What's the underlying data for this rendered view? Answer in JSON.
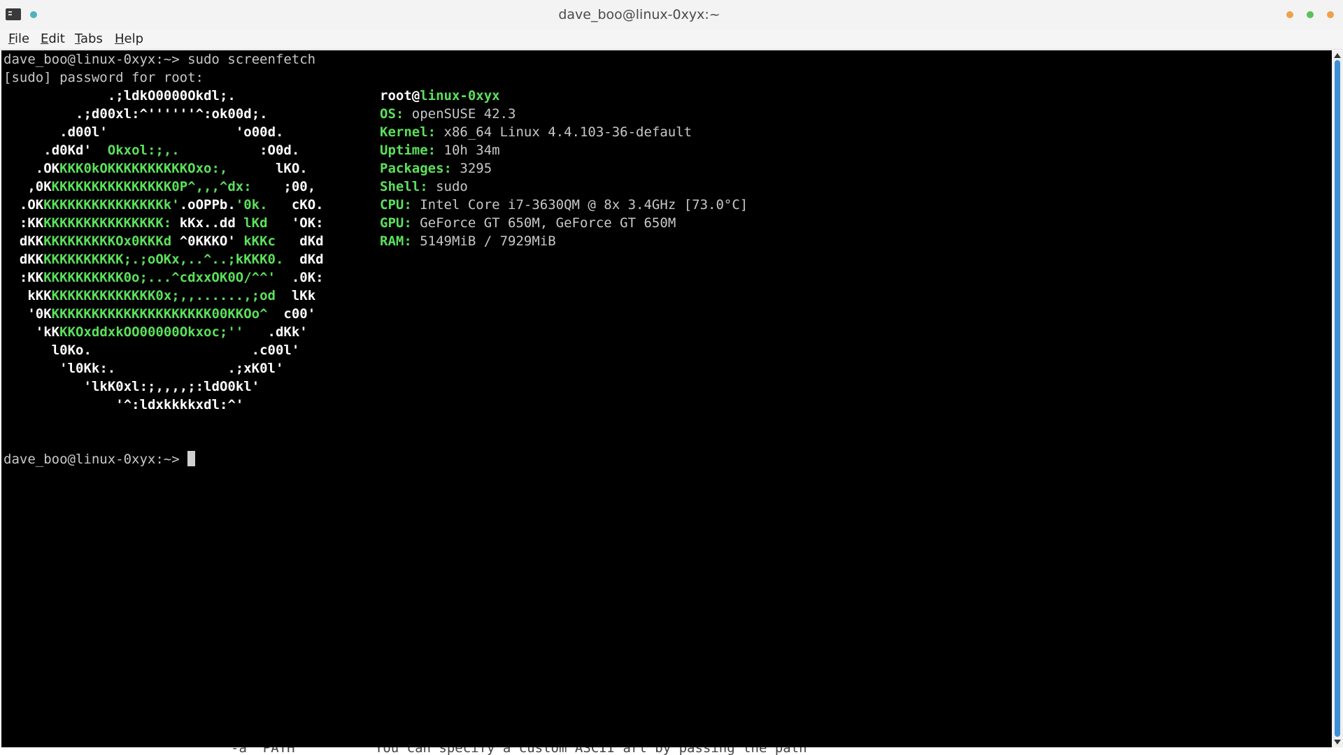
{
  "window": {
    "title": "dave_boo@linux-0xyx:~",
    "controls": {
      "minimize_color": "#f0a04b",
      "maximize_color": "#5cc05c",
      "close_color": "#f0a04b"
    }
  },
  "menu": {
    "items": [
      {
        "mnemonic": "F",
        "rest": "ile"
      },
      {
        "mnemonic": "E",
        "rest": "dit"
      },
      {
        "mnemonic": "T",
        "rest": "abs"
      },
      {
        "mnemonic": "H",
        "rest": "elp"
      }
    ]
  },
  "terminal": {
    "command_line": "dave_boo@linux-0xyx:~> sudo screenfetch",
    "sudo_prompt": "[sudo] password for root:",
    "final_prompt": "dave_boo@linux-0xyx:~> ",
    "colors": {
      "background": "#000000",
      "text": "#c8c8c8",
      "accent_green": "#5be05b"
    },
    "ascii_art": [
      {
        "indent": 13,
        "segments": [
          {
            "t": ".;ldkO0000Okdl;.",
            "g": false
          }
        ]
      },
      {
        "indent": 9,
        "segments": [
          {
            "t": ".;d00xl:^''''''^:ok00d;.",
            "g": false
          }
        ]
      },
      {
        "indent": 7,
        "segments": [
          {
            "t": ".d00l'",
            "g": false
          },
          {
            "t": "                ",
            "g": false
          },
          {
            "t": "'o00d.",
            "g": false
          }
        ]
      },
      {
        "indent": 5,
        "segments": [
          {
            "t": ".d0Kd'  ",
            "g": false
          },
          {
            "t": "Okxol:;,.",
            "g": true
          },
          {
            "t": "          :O0d.",
            "g": false
          }
        ]
      },
      {
        "indent": 4,
        "segments": [
          {
            "t": ".OK",
            "g": false
          },
          {
            "t": "KKK0kOKKKKKKKKKKOxo:,",
            "g": true
          },
          {
            "t": "      lKO.",
            "g": false
          }
        ]
      },
      {
        "indent": 3,
        "segments": [
          {
            "t": ",0K",
            "g": false
          },
          {
            "t": "KKKKKKKKKKKKKKK0P^,,,^dx:",
            "g": true
          },
          {
            "t": "    ;00,",
            "g": false
          }
        ]
      },
      {
        "indent": 2,
        "segments": [
          {
            "t": ".OK",
            "g": false
          },
          {
            "t": "KKKKKKKKKKKKKKKk'",
            "g": true
          },
          {
            "t": ".oOPPb.",
            "g": false
          },
          {
            "t": "'0k.",
            "g": true
          },
          {
            "t": "   cKO.",
            "g": false
          }
        ]
      },
      {
        "indent": 2,
        "segments": [
          {
            "t": ":KK",
            "g": false
          },
          {
            "t": "KKKKKKKKKKKKKKK:",
            "g": true
          },
          {
            "t": " kKx..dd ",
            "g": false
          },
          {
            "t": "lKd",
            "g": true
          },
          {
            "t": "   'OK:",
            "g": false
          }
        ]
      },
      {
        "indent": 2,
        "segments": [
          {
            "t": "dKK",
            "g": false
          },
          {
            "t": "KKKKKKKKKOx0KKKd",
            "g": true
          },
          {
            "t": " ^0KKKO' ",
            "g": false
          },
          {
            "t": "kKKc",
            "g": true
          },
          {
            "t": "   dKd",
            "g": false
          }
        ]
      },
      {
        "indent": 2,
        "segments": [
          {
            "t": "dKK",
            "g": false
          },
          {
            "t": "KKKKKKKKKK;.;oOKx,..^..;kKKK0.",
            "g": true
          },
          {
            "t": "  dKd",
            "g": false
          }
        ]
      },
      {
        "indent": 2,
        "segments": [
          {
            "t": ":KK",
            "g": false
          },
          {
            "t": "KKKKKKKKKK0o;...^cdxxOK0O/^^'",
            "g": true
          },
          {
            "t": "  .0K:",
            "g": false
          }
        ]
      },
      {
        "indent": 3,
        "segments": [
          {
            "t": "kKK",
            "g": false
          },
          {
            "t": "KKKKKKKKKKKKK0x;,,......,;od",
            "g": true
          },
          {
            "t": "  lKk",
            "g": false
          }
        ]
      },
      {
        "indent": 3,
        "segments": [
          {
            "t": "'0K",
            "g": false
          },
          {
            "t": "KKKKKKKKKKKKKKKKKKKK00KKOo^",
            "g": true
          },
          {
            "t": "  c00'",
            "g": false
          }
        ]
      },
      {
        "indent": 4,
        "segments": [
          {
            "t": "'kK",
            "g": false
          },
          {
            "t": "KKOxddxkOO00000Okxoc;''",
            "g": true
          },
          {
            "t": "   .dKk'",
            "g": false
          }
        ]
      },
      {
        "indent": 6,
        "segments": [
          {
            "t": "l0Ko.",
            "g": false
          },
          {
            "t": "                    .c00l'",
            "g": false
          }
        ]
      },
      {
        "indent": 7,
        "segments": [
          {
            "t": "'l0Kk:.",
            "g": false
          },
          {
            "t": "              .;xK0l'",
            "g": false
          }
        ]
      },
      {
        "indent": 10,
        "segments": [
          {
            "t": "'lkK0xl:;,,,,;:ldO0kl'",
            "g": false
          }
        ]
      },
      {
        "indent": 14,
        "segments": [
          {
            "t": "'^:ldxkkkkxdl:^'",
            "g": false
          }
        ]
      }
    ],
    "info_header": {
      "user": "root",
      "at": "@",
      "host": "linux-0xyx"
    },
    "info": [
      {
        "key": "OS:",
        "value": "openSUSE 42.3"
      },
      {
        "key": "Kernel:",
        "value": "x86_64 Linux 4.4.103-36-default"
      },
      {
        "key": "Uptime:",
        "value": "10h 34m"
      },
      {
        "key": "Packages:",
        "value": "3295"
      },
      {
        "key": "Shell:",
        "value": "sudo"
      },
      {
        "key": "CPU:",
        "value": "Intel Core i7-3630QM @ 8x 3.4GHz [73.0°C]"
      },
      {
        "key": "GPU:",
        "value": "GeForce GT 650M, GeForce GT 650M"
      },
      {
        "key": "RAM:",
        "value": "5149MiB / 7929MiB"
      }
    ]
  },
  "background_window": {
    "visible_text": "-a  PATH          You can specify a custom ASCII art by passing the path"
  }
}
